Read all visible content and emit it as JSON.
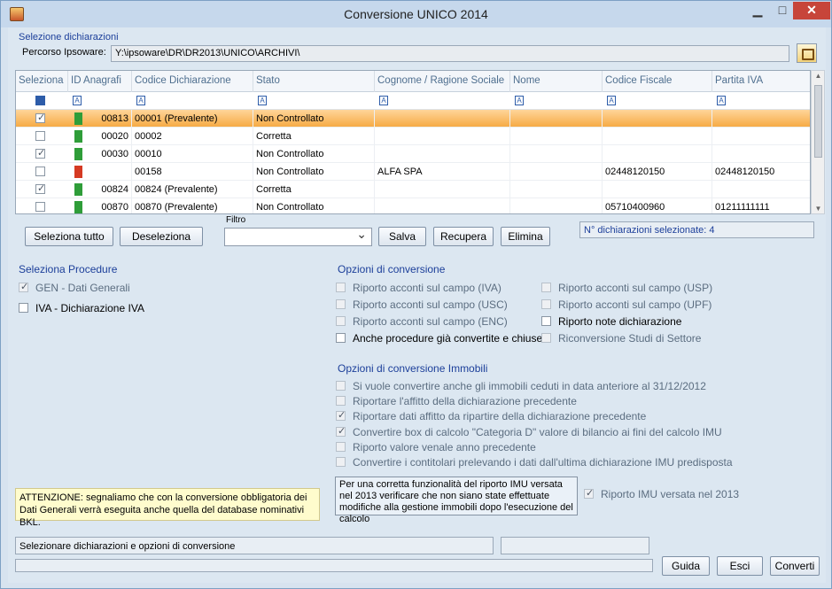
{
  "window": {
    "title": "Conversione UNICO 2014",
    "min_label": "▁",
    "max_label": "□",
    "close_label": "✕"
  },
  "selection": {
    "section_label": "Selezione dichiarazioni",
    "path_label": "Percorso Ipsoware:",
    "path_value": "Y:\\ipsoware\\DR\\DR2013\\UNICO\\ARCHIVI\\"
  },
  "table": {
    "columns": [
      "Seleziona",
      "ID Anagrafi",
      "Codice Dichiarazione",
      "Stato",
      "Cognome / Ragione Sociale",
      "Nome",
      "Codice Fiscale",
      "Partita IVA"
    ],
    "rows": [
      {
        "checked": true,
        "status_color": "green",
        "id": "00813",
        "code": "00001  (Prevalente)",
        "state": "Non Controllato",
        "surname": "",
        "name": "",
        "cf": "",
        "piva": "",
        "selected": true
      },
      {
        "checked": false,
        "status_color": "green",
        "id": "00020",
        "code": "00002",
        "state": "Corretta",
        "surname": "",
        "name": "",
        "cf": "",
        "piva": "",
        "selected": false
      },
      {
        "checked": true,
        "status_color": "green",
        "id": "00030",
        "code": "00010",
        "state": "Non Controllato",
        "surname": "",
        "name": "",
        "cf": "",
        "piva": "",
        "selected": false
      },
      {
        "checked": false,
        "status_color": "red",
        "id": "",
        "code": "00158",
        "state": "Non Controllato",
        "surname": "ALFA SPA",
        "name": "",
        "cf": "02448120150",
        "piva": "02448120150",
        "selected": false
      },
      {
        "checked": true,
        "status_color": "green",
        "id": "00824",
        "code": "00824  (Prevalente)",
        "state": "Corretta",
        "surname": "",
        "name": "",
        "cf": "",
        "piva": "",
        "selected": false
      },
      {
        "checked": false,
        "status_color": "green",
        "id": "00870",
        "code": "00870  (Prevalente)",
        "state": "Non Controllato",
        "surname": "",
        "name": "",
        "cf": "05710400960",
        "piva": "01211111111",
        "selected": false
      }
    ]
  },
  "buttons": {
    "select_all": "Seleziona tutto",
    "deselect": "Deseleziona",
    "save": "Salva",
    "recover": "Recupera",
    "delete": "Elimina",
    "help": "Guida",
    "exit": "Esci",
    "convert": "Converti"
  },
  "filter": {
    "label": "Filtro",
    "value": ""
  },
  "selected_count": "N° dichiarazioni selezionate: 4",
  "procedures": {
    "title": "Seleziona Procedure",
    "items": [
      {
        "label": "GEN - Dati Generali",
        "checked": true,
        "disabled": true
      },
      {
        "label": "IVA - Dichiarazione IVA",
        "checked": false,
        "disabled": false
      }
    ]
  },
  "conversion_options": {
    "title": "Opzioni di conversione",
    "left": [
      {
        "label": "Riporto acconti sul campo (IVA)",
        "checked": false,
        "disabled": true
      },
      {
        "label": "Riporto acconti sul campo (USC)",
        "checked": false,
        "disabled": true
      },
      {
        "label": "Riporto acconti sul campo (ENC)",
        "checked": false,
        "disabled": true
      },
      {
        "label": "Anche procedure già convertite e chiuse",
        "checked": false,
        "disabled": false
      }
    ],
    "right": [
      {
        "label": "Riporto acconti sul campo (USP)",
        "checked": false,
        "disabled": true
      },
      {
        "label": "Riporto acconti sul campo (UPF)",
        "checked": false,
        "disabled": true
      },
      {
        "label": "Riporto note dichiarazione",
        "checked": false,
        "disabled": false
      },
      {
        "label": "Riconversione Studi di Settore",
        "checked": false,
        "disabled": true
      }
    ]
  },
  "property_options": {
    "title": "Opzioni di conversione Immobili",
    "items": [
      {
        "label": "Si vuole convertire anche gli immobili ceduti in data anteriore al 31/12/2012",
        "checked": false,
        "disabled": true
      },
      {
        "label": "Riportare l'affitto della dichiarazione precedente",
        "checked": false,
        "disabled": true
      },
      {
        "label": "Riportare dati affitto da ripartire della dichiarazione precedente",
        "checked": true,
        "disabled": true
      },
      {
        "label": "Convertire box di calcolo \"Categoria D\" valore di bilancio ai fini del calcolo IMU",
        "checked": true,
        "disabled": true
      },
      {
        "label": "Riporto valore venale anno precedente",
        "checked": false,
        "disabled": true
      },
      {
        "label": "Convertire i contitolari prelevando i dati dall'ultima dichiarazione IMU predisposta",
        "checked": false,
        "disabled": true
      }
    ]
  },
  "imu_note": "Per una corretta funzionalità del riporto IMU versata nel 2013 verificare che non siano state effettuate modifiche alla gestione immobili dopo l'esecuzione del calcolo",
  "imu_option": {
    "label": "Riporto IMU versata nel 2013",
    "checked": true,
    "disabled": true
  },
  "warning": "ATTENZIONE: segnaliamo che con la conversione obbligatoria dei Dati Generali verrà eseguita anche quella del database nominativi BKL.",
  "status": {
    "text": "Selezionare dichiarazioni e opzioni di conversione",
    "secondary": ""
  },
  "progress": {
    "value": 0
  }
}
